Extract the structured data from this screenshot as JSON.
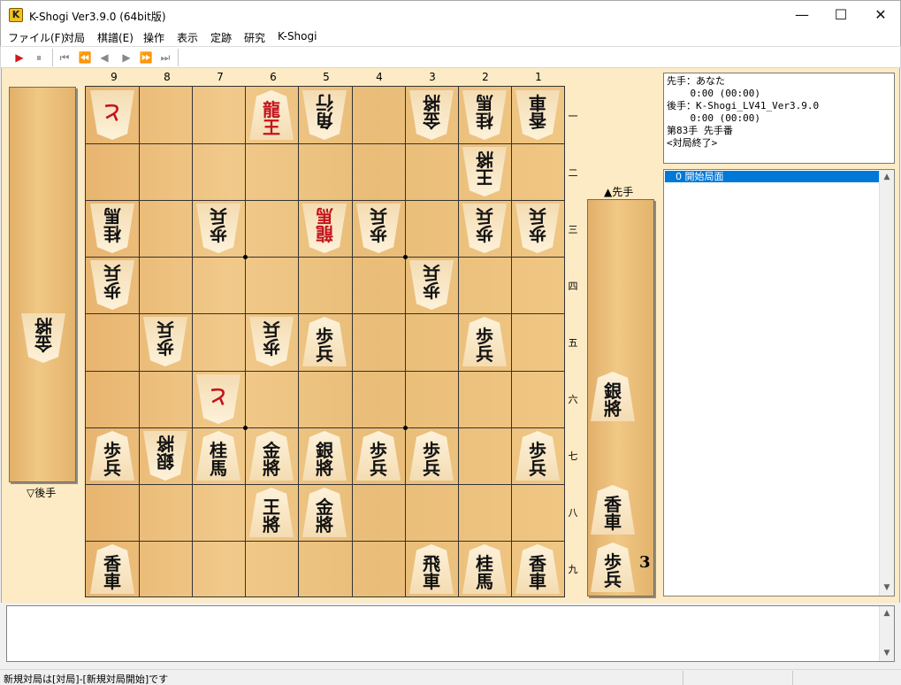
{
  "window": {
    "title": "K-Shogi Ver3.9.0 (64bit版)",
    "app_icon_letter": "K",
    "minimize": "—",
    "maximize": "☐",
    "close": "✕"
  },
  "menu": [
    "ファイル(F)",
    "対局",
    "棋譜(E)",
    "操作",
    "表示",
    "定跡",
    "研究",
    "K-Shogi"
  ],
  "toolbar": {
    "play": "▶",
    "pause": "⏸",
    "first": "⏮",
    "fast_back": "⏪",
    "back": "◀",
    "forward": "▶",
    "fast_forward": "⏩",
    "last": "⏭"
  },
  "board": {
    "col_labels": [
      "9",
      "8",
      "7",
      "6",
      "5",
      "4",
      "3",
      "2",
      "1"
    ],
    "row_labels": [
      "一",
      "二",
      "三",
      "四",
      "五",
      "六",
      "七",
      "八",
      "九"
    ],
    "pieces": [
      {
        "col": 9,
        "row": 1,
        "chars": [
          "と"
        ],
        "gote": true,
        "red": true
      },
      {
        "col": 6,
        "row": 1,
        "chars": [
          "龍",
          "王"
        ],
        "gote": false,
        "red": true
      },
      {
        "col": 5,
        "row": 1,
        "chars": [
          "角",
          "行"
        ],
        "gote": true,
        "red": false
      },
      {
        "col": 3,
        "row": 1,
        "chars": [
          "金",
          "將"
        ],
        "gote": true,
        "red": false
      },
      {
        "col": 2,
        "row": 1,
        "chars": [
          "桂",
          "馬"
        ],
        "gote": true,
        "red": false
      },
      {
        "col": 1,
        "row": 1,
        "chars": [
          "香",
          "車"
        ],
        "gote": true,
        "red": false
      },
      {
        "col": 2,
        "row": 2,
        "chars": [
          "王",
          "將"
        ],
        "gote": true,
        "red": false
      },
      {
        "col": 9,
        "row": 3,
        "chars": [
          "桂",
          "馬"
        ],
        "gote": true,
        "red": false
      },
      {
        "col": 7,
        "row": 3,
        "chars": [
          "歩",
          "兵"
        ],
        "gote": true,
        "red": false
      },
      {
        "col": 5,
        "row": 3,
        "chars": [
          "龍",
          "馬"
        ],
        "gote": true,
        "red": true
      },
      {
        "col": 4,
        "row": 3,
        "chars": [
          "歩",
          "兵"
        ],
        "gote": true,
        "red": false
      },
      {
        "col": 2,
        "row": 3,
        "chars": [
          "歩",
          "兵"
        ],
        "gote": true,
        "red": false
      },
      {
        "col": 1,
        "row": 3,
        "chars": [
          "歩",
          "兵"
        ],
        "gote": true,
        "red": false
      },
      {
        "col": 9,
        "row": 4,
        "chars": [
          "歩",
          "兵"
        ],
        "gote": true,
        "red": false
      },
      {
        "col": 3,
        "row": 4,
        "chars": [
          "歩",
          "兵"
        ],
        "gote": true,
        "red": false
      },
      {
        "col": 8,
        "row": 5,
        "chars": [
          "歩",
          "兵"
        ],
        "gote": true,
        "red": false
      },
      {
        "col": 6,
        "row": 5,
        "chars": [
          "歩",
          "兵"
        ],
        "gote": true,
        "red": false
      },
      {
        "col": 5,
        "row": 5,
        "chars": [
          "歩",
          "兵"
        ],
        "gote": false,
        "red": false
      },
      {
        "col": 2,
        "row": 5,
        "chars": [
          "歩",
          "兵"
        ],
        "gote": false,
        "red": false
      },
      {
        "col": 7,
        "row": 6,
        "chars": [
          "と"
        ],
        "gote": true,
        "red": true
      },
      {
        "col": 9,
        "row": 7,
        "chars": [
          "歩",
          "兵"
        ],
        "gote": false,
        "red": false
      },
      {
        "col": 8,
        "row": 7,
        "chars": [
          "銀",
          "將"
        ],
        "gote": true,
        "red": false
      },
      {
        "col": 7,
        "row": 7,
        "chars": [
          "桂",
          "馬"
        ],
        "gote": false,
        "red": false
      },
      {
        "col": 6,
        "row": 7,
        "chars": [
          "金",
          "將"
        ],
        "gote": false,
        "red": false
      },
      {
        "col": 5,
        "row": 7,
        "chars": [
          "銀",
          "將"
        ],
        "gote": false,
        "red": false
      },
      {
        "col": 4,
        "row": 7,
        "chars": [
          "歩",
          "兵"
        ],
        "gote": false,
        "red": false
      },
      {
        "col": 3,
        "row": 7,
        "chars": [
          "歩",
          "兵"
        ],
        "gote": false,
        "red": false
      },
      {
        "col": 1,
        "row": 7,
        "chars": [
          "歩",
          "兵"
        ],
        "gote": false,
        "red": false
      },
      {
        "col": 6,
        "row": 8,
        "chars": [
          "王",
          "將"
        ],
        "gote": false,
        "red": false
      },
      {
        "col": 5,
        "row": 8,
        "chars": [
          "金",
          "將"
        ],
        "gote": false,
        "red": false
      },
      {
        "col": 9,
        "row": 9,
        "chars": [
          "香",
          "車"
        ],
        "gote": false,
        "red": false
      },
      {
        "col": 3,
        "row": 9,
        "chars": [
          "飛",
          "車"
        ],
        "gote": false,
        "red": false
      },
      {
        "col": 2,
        "row": 9,
        "chars": [
          "桂",
          "馬"
        ],
        "gote": false,
        "red": false
      },
      {
        "col": 1,
        "row": 9,
        "chars": [
          "香",
          "車"
        ],
        "gote": false,
        "red": false
      }
    ]
  },
  "gote_stand": {
    "label": "▽後手",
    "pieces": [
      {
        "chars": [
          "金",
          "將"
        ],
        "count": ""
      }
    ]
  },
  "sente_stand": {
    "label": "▲先手",
    "pieces": [
      {
        "chars": [
          "銀",
          "將"
        ],
        "count": ""
      },
      {
        "chars": [
          "香",
          "車"
        ],
        "count": ""
      },
      {
        "chars": [
          "歩",
          "兵"
        ],
        "count": "3"
      }
    ]
  },
  "info": {
    "sente_line": "先手：あなた",
    "sente_time": "    0:00 (00:00)",
    "gote_line": "後手：K-Shogi_LV41_Ver3.9.0",
    "gote_time": "    0:00 (00:00)",
    "move_line": "第83手 先手番",
    "status_line": "<対局終了>"
  },
  "kifu": {
    "selected": "0 開始局面"
  },
  "scroll": {
    "up": "▲",
    "down": "▼"
  },
  "status_bar": {
    "text": "新規対局は[対局]-[新規対局開始]です"
  }
}
